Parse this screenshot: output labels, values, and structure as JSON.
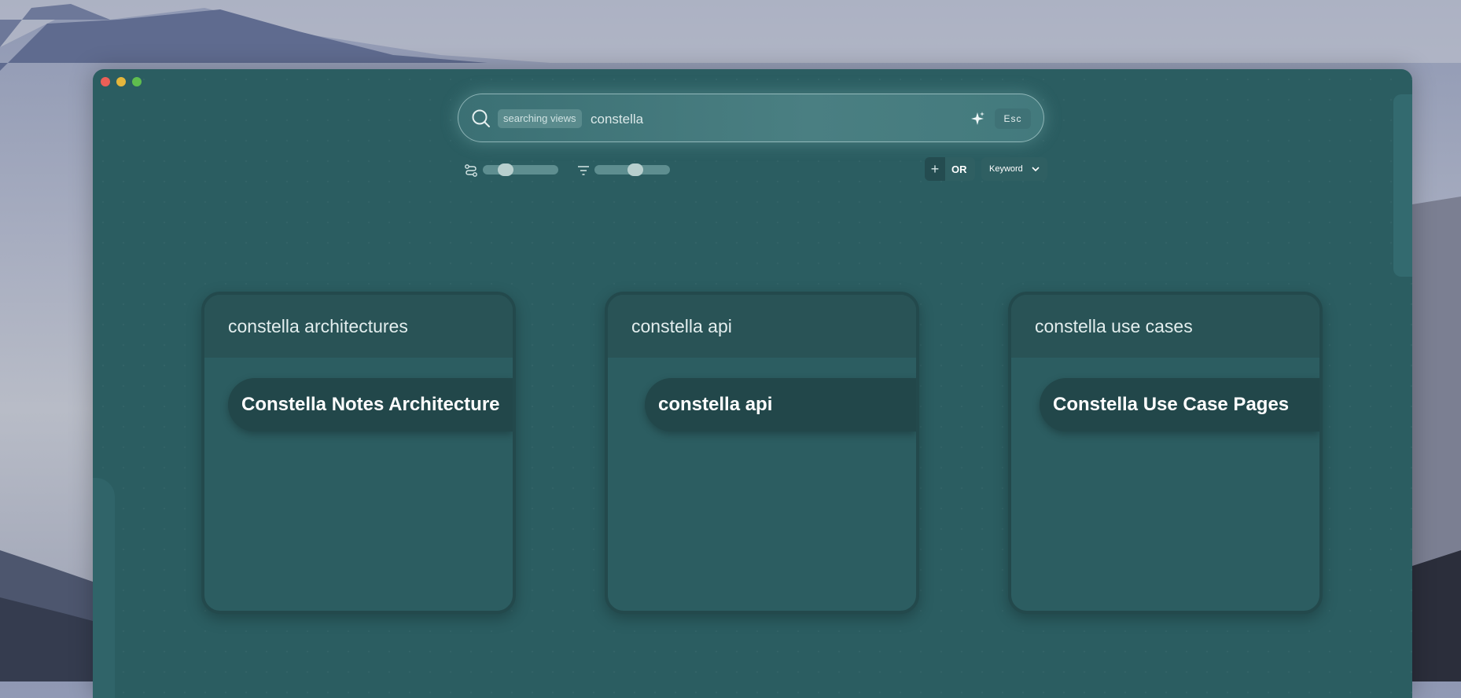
{
  "window": {
    "controls": [
      "close",
      "minimize",
      "maximize"
    ]
  },
  "search": {
    "mode_badge": "searching views",
    "query": "constella",
    "esc_label": "Esc",
    "icons": [
      "search-icon",
      "sparkle-icon"
    ]
  },
  "controls": {
    "slider_1": {
      "icon": "flow-icon",
      "level": 0.25
    },
    "slider_2": {
      "icon": "filter-icon",
      "level": 0.55
    },
    "or_toggle": {
      "plus": "+",
      "label": "OR"
    },
    "keyword_select": {
      "value": "Keyword",
      "icon": "chevron-down-icon"
    }
  },
  "cards": [
    {
      "title": "constella architectures",
      "item": "Constella Notes Architecture"
    },
    {
      "title": "constella api",
      "item": "constella api"
    },
    {
      "title": "constella use cases",
      "item": "Constella Use Case Pages"
    }
  ],
  "colors": {
    "window_bg": "#2b5d61",
    "card_border": "#23494c",
    "card_item_bg": "#22474a",
    "close": "#ec5f57",
    "minimize": "#e5b63c",
    "maximize": "#5fbd4e"
  }
}
